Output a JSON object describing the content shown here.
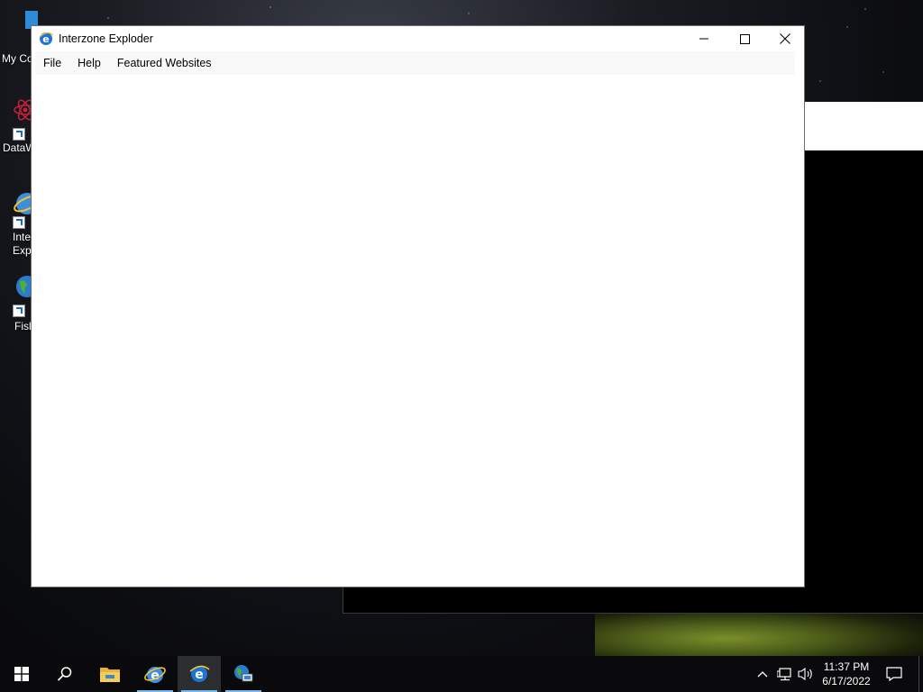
{
  "desktop": {
    "icons": [
      {
        "label": "My Co",
        "icon": "computer-icon"
      },
      {
        "label": "DataW",
        "icon": "atom-icon"
      },
      {
        "label": "Inte\nExp",
        "icon": "internet-explorer-icon"
      },
      {
        "label": "Fish",
        "icon": "globe-icon"
      }
    ]
  },
  "window": {
    "title": "Interzone Exploder",
    "menu": [
      "File",
      "Help",
      "Featured Websites"
    ],
    "controls": {
      "minimize": "minimize-icon",
      "maximize": "maximize-icon",
      "close": "close-icon"
    }
  },
  "taskbar": {
    "items": [
      "start-icon",
      "search-icon",
      "file-explorer-icon",
      "edge-icon",
      "interzone-exploder-icon",
      "network-app-icon"
    ],
    "tray": [
      "chevron-up-icon",
      "network-icon",
      "volume-icon"
    ],
    "time": "11:37 PM",
    "date": "6/17/2022",
    "notifications_icon": "action-center-icon"
  },
  "colors": {
    "accent": "#76b9ed",
    "ie_blue": "#1e73d6"
  }
}
